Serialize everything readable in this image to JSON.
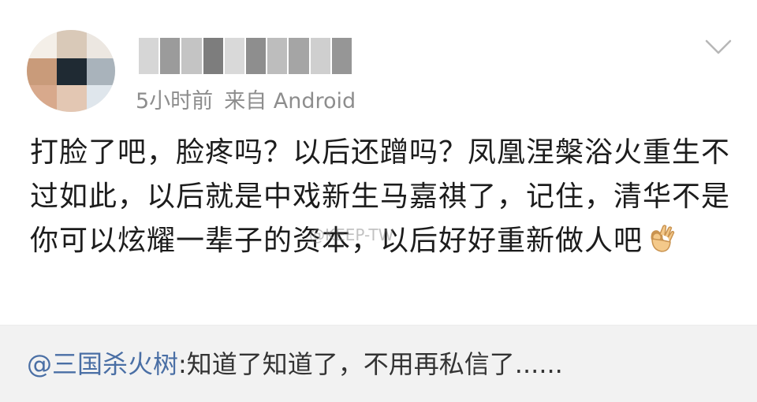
{
  "post": {
    "time": "5小时前",
    "source": "来自 Android",
    "content": "打脸了吧，脸疼吗？以后还蹭吗？凤凰涅槃浴火重生不过如此，以后就是中戏新生马嘉祺了，记住，清华不是你可以炫耀一辈子的资本，以后好好重新做人吧",
    "emoji": "ok-hand-icon",
    "watermark": "@KEEP-TW"
  },
  "comment": {
    "mention": "@三国杀火树",
    "text": ":知道了知道了，不用再私信了......"
  },
  "colors": {
    "mention": "#4a6fa5",
    "text": "#1c1c1c",
    "meta": "#8d8d8d",
    "comment_bg": "#f2f2f2"
  }
}
